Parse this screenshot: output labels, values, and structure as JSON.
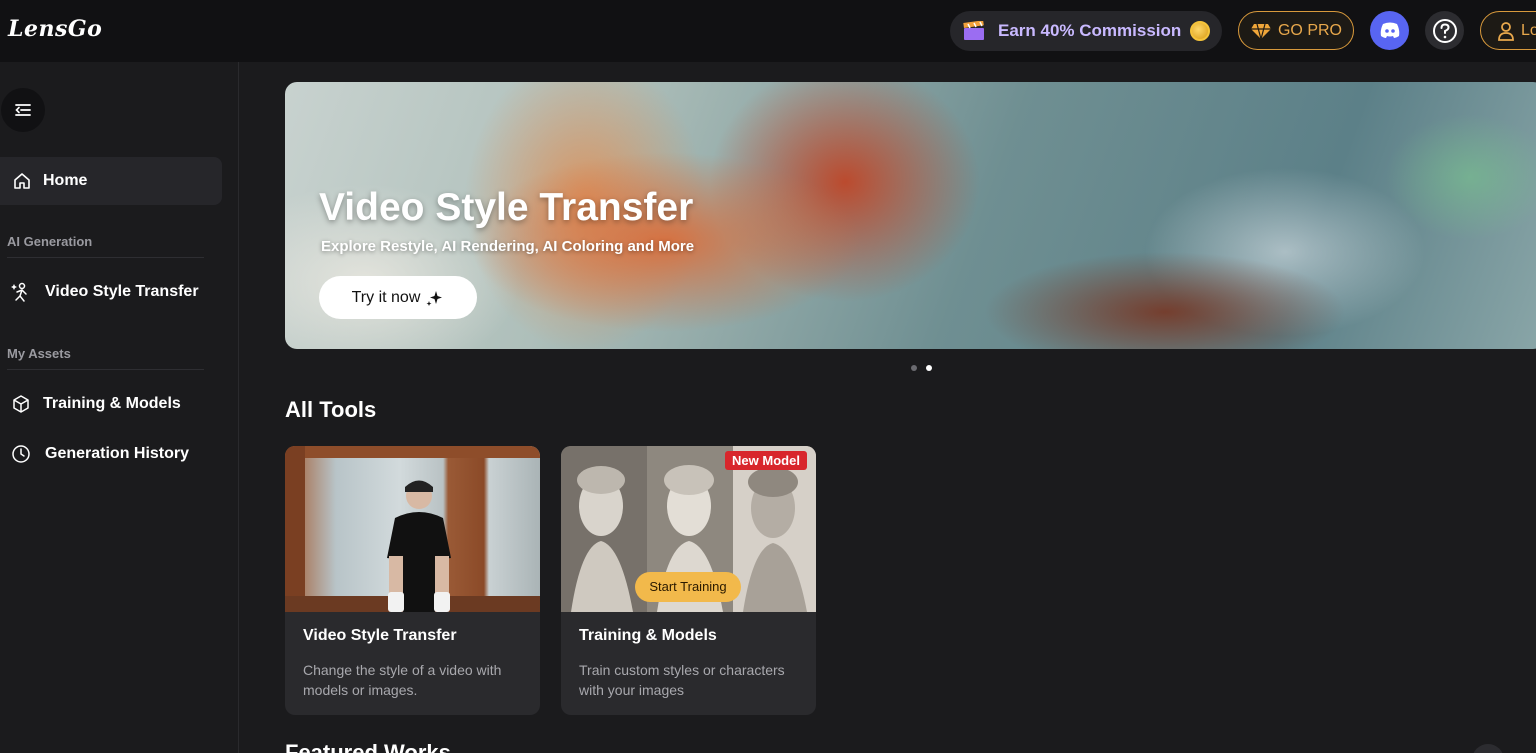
{
  "header": {
    "logo": "LensGo",
    "earn_label": "Earn 40% Commission",
    "gopro_label": "GO PRO",
    "login_label": "Lo"
  },
  "sidebar": {
    "home_label": "Home",
    "section_ai": "AI Generation",
    "video_style_label": "Video Style Transfer",
    "section_assets": "My Assets",
    "training_label": "Training & Models",
    "history_label": "Generation History"
  },
  "banner": {
    "title": "Video Style Transfer",
    "subtitle": "Explore Restyle, AI Rendering, AI Coloring and More",
    "cta": "Try it now",
    "slide_count": 2,
    "active_slide": 2
  },
  "tools": {
    "heading": "All Tools",
    "cards": [
      {
        "title": "Video Style Transfer",
        "description": "Change the style of a video with models or images."
      },
      {
        "title": "Training & Models",
        "description": "Train custom styles or characters with your images",
        "badge": "New Model",
        "action": "Start Training"
      }
    ]
  },
  "featured": {
    "heading": "Featured Works"
  },
  "colors": {
    "accent_gold": "#e8a84c",
    "discord": "#5865f2",
    "badge_red": "#d8262c",
    "start_training": "#f2b94b"
  }
}
